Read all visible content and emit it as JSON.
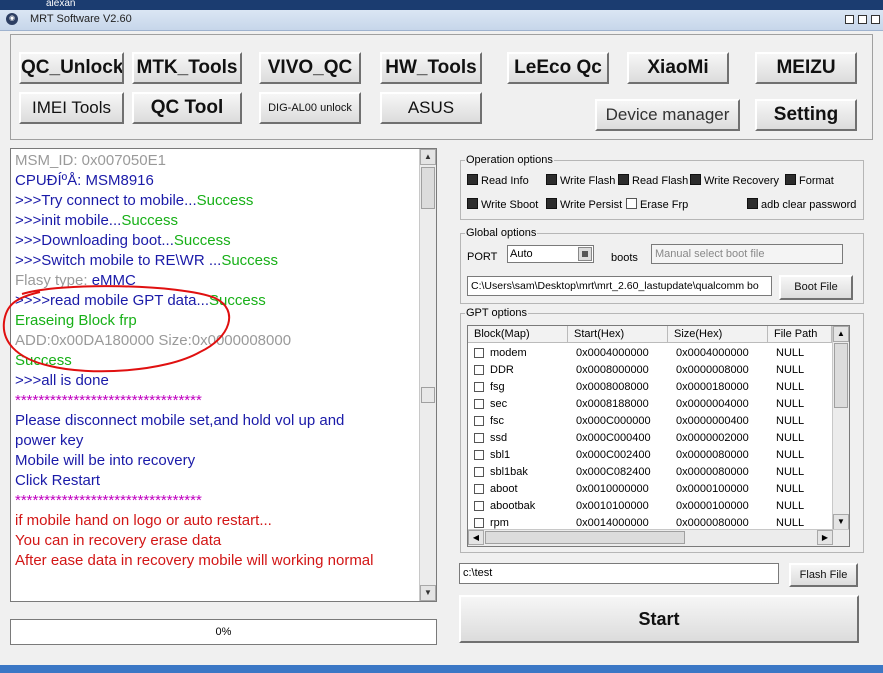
{
  "taskbar": {
    "user": "alexan"
  },
  "window": {
    "title": "MRT Software V2.60",
    "icon": "app-logo-icon"
  },
  "toolbar": {
    "row1": [
      "QC_Unlock",
      "MTK_Tools",
      "VIVO_QC",
      "HW_Tools",
      "LeEco Qc",
      "XiaoMi",
      "MEIZU"
    ],
    "row2": [
      "IMEI Tools",
      "QC Tool",
      "DIG-AL00 unlock",
      "ASUS"
    ],
    "device_manager": "Device manager",
    "setting": "Setting"
  },
  "log": {
    "lines": [
      [
        {
          "t": "   MSM_ID:  0x007050E1",
          "c": "gray"
        }
      ],
      [
        {
          "t": "   CPUÐÍºÅ: MSM8916",
          "c": "blue"
        }
      ],
      [
        {
          "t": ">>>Try connect to mobile...",
          "c": "blue"
        },
        {
          "t": "Success",
          "c": "green"
        }
      ],
      [
        {
          "t": ">>>init mobile...",
          "c": "blue"
        },
        {
          "t": "Success",
          "c": "green"
        }
      ],
      [
        {
          "t": ">>>Downloading boot...",
          "c": "blue"
        },
        {
          "t": "Success",
          "c": "green"
        }
      ],
      [
        {
          "t": ">>>Switch mobile to RE\\WR ...",
          "c": "blue"
        },
        {
          "t": "Success",
          "c": "green"
        }
      ],
      [
        {
          "t": "   Flasy type:  ",
          "c": "gray"
        },
        {
          "t": "eMMC",
          "c": "blue"
        }
      ],
      [
        {
          "t": ">>>>read mobile GPT data...",
          "c": "blue"
        },
        {
          "t": "Success",
          "c": "green"
        }
      ],
      [
        {
          "t": "   Eraseing Block  frp",
          "c": "green"
        }
      ],
      [
        {
          "t": "  ADD:0x00DA180000   Size:0x0000008000",
          "c": "gray"
        }
      ],
      [
        {
          "t": "Success",
          "c": "green"
        }
      ],
      [
        {
          "t": ">>>all is done",
          "c": "blue"
        }
      ],
      [
        {
          "t": "   ********************************",
          "c": "purple"
        }
      ],
      [
        {
          "t": "   Please disconnect mobile set,and hold vol up and",
          "c": "blue"
        }
      ],
      [
        {
          "t": "power key",
          "c": "blue"
        }
      ],
      [
        {
          "t": "   Mobile will be into recovery",
          "c": "blue"
        }
      ],
      [
        {
          "t": "   Click Restart",
          "c": "blue"
        }
      ],
      [
        {
          "t": "   ********************************",
          "c": "purple"
        }
      ],
      [
        {
          "t": "   if mobile hand on logo or auto restart...",
          "c": "red"
        }
      ],
      [
        {
          "t": "   You can in recovery erase data",
          "c": "red"
        }
      ],
      [
        {
          "t": "   After ease data in recovery mobile will working normal",
          "c": "red"
        }
      ]
    ]
  },
  "progress": {
    "label": "0%",
    "value": 0
  },
  "operation_options": {
    "legend": "Operation options",
    "items": [
      {
        "label": "Read Info",
        "checked": true
      },
      {
        "label": "Write Flash",
        "checked": true
      },
      {
        "label": "Read Flash",
        "checked": true
      },
      {
        "label": "Write Recovery",
        "checked": true
      },
      {
        "label": "Format",
        "checked": true
      },
      {
        "label": "Write Sboot",
        "checked": true
      },
      {
        "label": "Write Persist",
        "checked": true
      },
      {
        "label": "Erase Frp",
        "checked": false
      },
      {
        "label": "adb clear password",
        "checked": true
      }
    ]
  },
  "global_options": {
    "legend": "Global options",
    "port_label": "PORT",
    "port_value": "Auto",
    "boots_label": "boots",
    "boots_placeholder": "Manual select boot file",
    "boot_path": "C:\\Users\\sam\\Desktop\\mrt\\mrt_2.60_lastupdate\\qualcomm bo",
    "boot_file_button": "Boot File"
  },
  "gpt_options": {
    "legend": "GPT options",
    "columns": [
      "Block(Map)",
      "Start(Hex)",
      "Size(Hex)",
      "File Path"
    ],
    "rows": [
      [
        "modem",
        "0x0004000000",
        "0x0004000000",
        "NULL"
      ],
      [
        "DDR",
        "0x0008000000",
        "0x0000008000",
        "NULL"
      ],
      [
        "fsg",
        "0x0008008000",
        "0x0000180000",
        "NULL"
      ],
      [
        "sec",
        "0x0008188000",
        "0x0000004000",
        "NULL"
      ],
      [
        "fsc",
        "0x000C000000",
        "0x0000000400",
        "NULL"
      ],
      [
        "ssd",
        "0x000C000400",
        "0x0000002000",
        "NULL"
      ],
      [
        "sbl1",
        "0x000C002400",
        "0x0000080000",
        "NULL"
      ],
      [
        "sbl1bak",
        "0x000C082400",
        "0x0000080000",
        "NULL"
      ],
      [
        "aboot",
        "0x0010000000",
        "0x0000100000",
        "NULL"
      ],
      [
        "abootbak",
        "0x0010100000",
        "0x0000100000",
        "NULL"
      ],
      [
        "rpm",
        "0x0014000000",
        "0x0000080000",
        "NULL"
      ]
    ]
  },
  "flash": {
    "path": "c:\\test",
    "button": "Flash File"
  },
  "start_button": "Start",
  "colors": {
    "blue": "#1a1aa8",
    "green": "#18b018",
    "gray": "#9a9a9a",
    "red": "#d21616",
    "purple": "#c000c0",
    "annotation": "#e01010"
  }
}
